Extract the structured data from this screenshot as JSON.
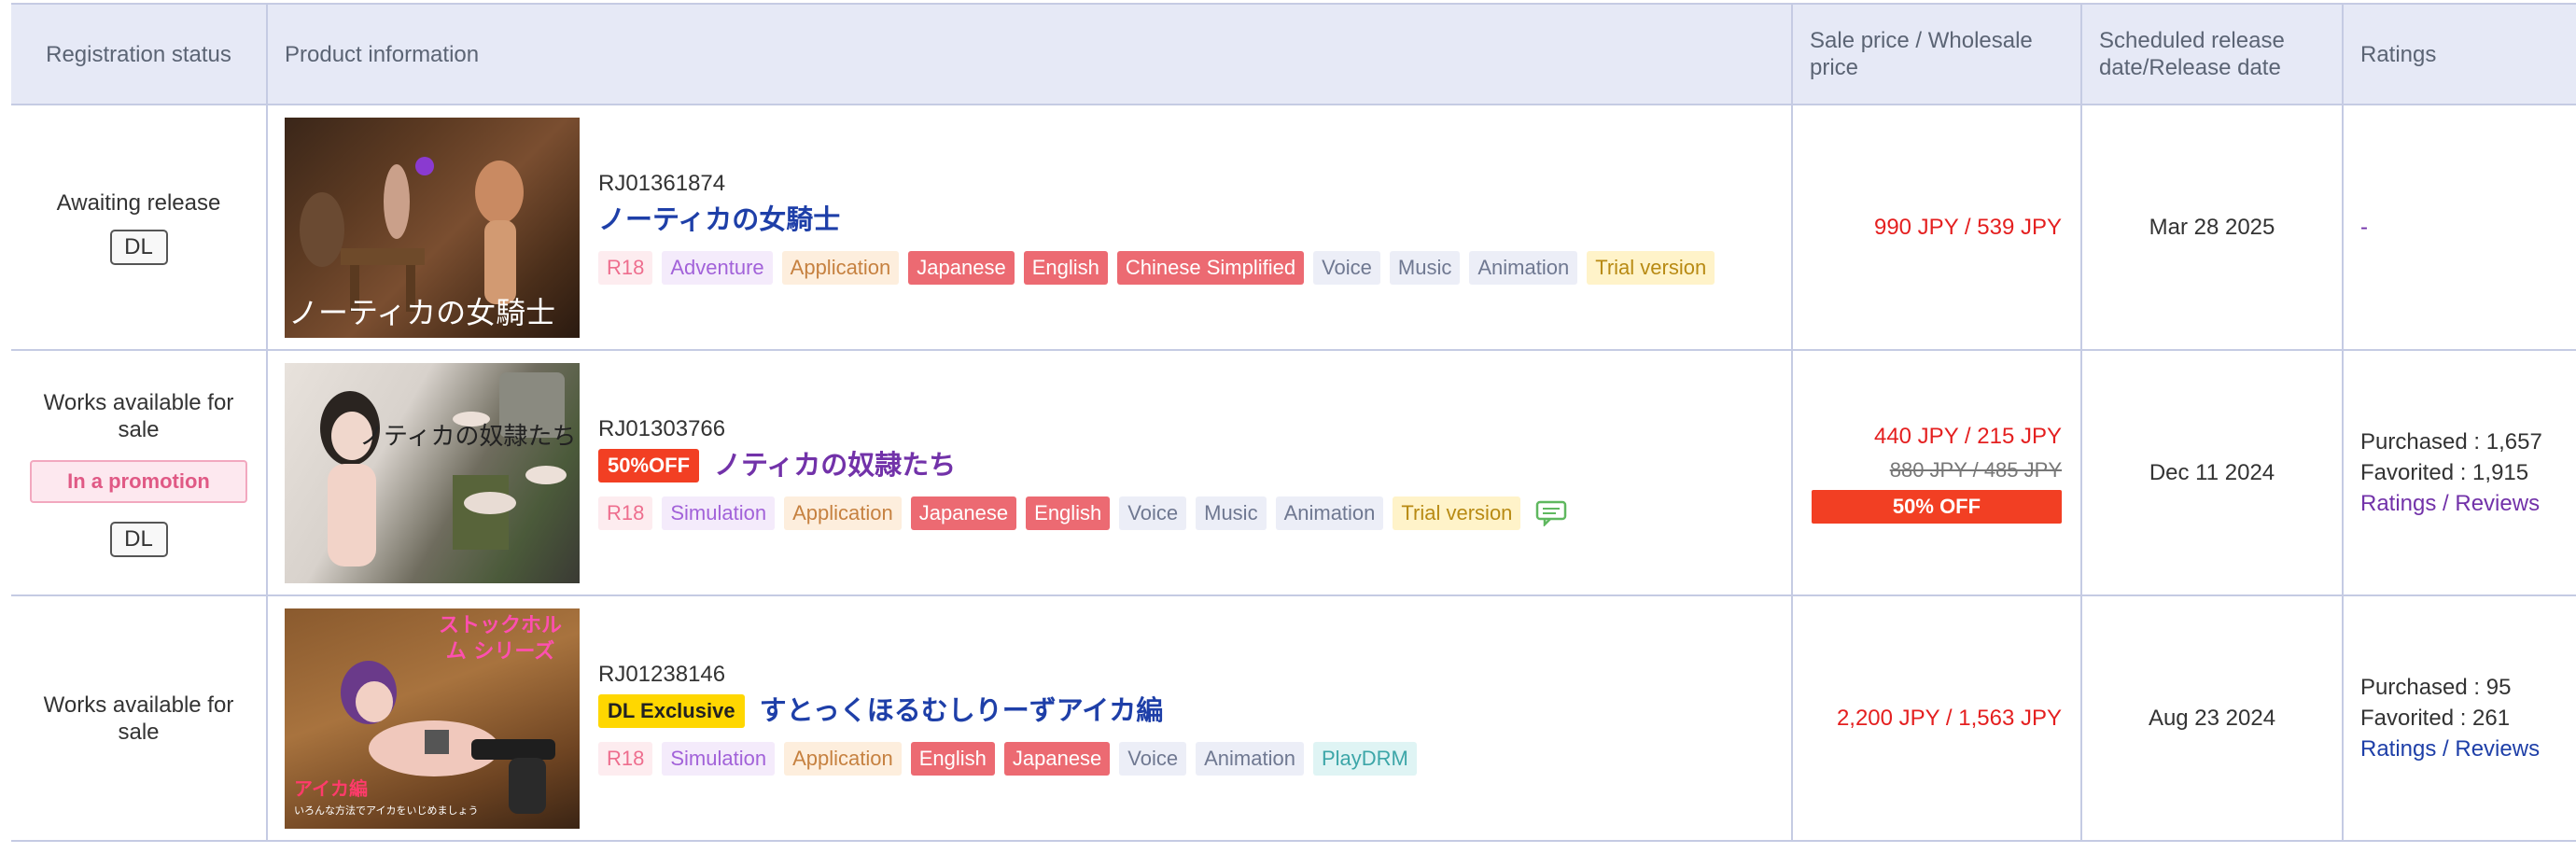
{
  "columns": {
    "status": "Registration status",
    "product": "Product information",
    "price": "Sale price / Wholesale price",
    "date": "Scheduled release date/Release date",
    "ratings": "Ratings"
  },
  "rows": [
    {
      "status": "Awaiting release",
      "promo": "",
      "dl_badge": "DL",
      "thumb_text": "ノーティカの女騎士",
      "work_id": "RJ01361874",
      "title": "ノーティカの女騎士",
      "pre_badge": "",
      "tags": [
        "R18",
        "Adventure",
        "Application",
        "Japanese",
        "English",
        "Chinese Simplified",
        "Voice",
        "Music",
        "Animation",
        "Trial version"
      ],
      "price": "990 JPY / 539 JPY",
      "old_price": "",
      "off_label": "",
      "date": "Mar 28 2025",
      "purchased": "",
      "favorited": "",
      "reviews_link": "",
      "ratings_empty": "-"
    },
    {
      "status": "Works available for sale",
      "promo": "In a promotion",
      "dl_badge": "DL",
      "thumb_text": "ノティカの奴隷たち",
      "work_id": "RJ01303766",
      "title": "ノティカの奴隷たち",
      "pre_badge": "50%OFF",
      "tags": [
        "R18",
        "Simulation",
        "Application",
        "Japanese",
        "English",
        "Voice",
        "Music",
        "Animation",
        "Trial version"
      ],
      "price": "440 JPY / 215 JPY",
      "old_price": "880 JPY / 485 JPY",
      "off_label": "50% OFF",
      "date": "Dec 11 2024",
      "purchased": "Purchased : 1,657",
      "favorited": "Favorited : 1,915",
      "reviews_link": "Ratings / Reviews",
      "ratings_empty": ""
    },
    {
      "status": "Works available for sale",
      "promo": "",
      "dl_badge": "",
      "thumb_text": "ストックホルム シリーズ",
      "thumb_sub": "アイカ編",
      "thumb_caption": "いろんな方法でアイカをいじめましょう",
      "work_id": "RJ01238146",
      "title": "すとっくほるむしりーずアイカ編",
      "pre_badge": "DL Exclusive",
      "tags": [
        "R18",
        "Simulation",
        "Application",
        "English",
        "Japanese",
        "Voice",
        "Animation",
        "PlayDRM"
      ],
      "price": "2,200 JPY / 1,563 JPY",
      "old_price": "",
      "off_label": "",
      "date": "Aug 23 2024",
      "purchased": "Purchased : 95",
      "favorited": "Favorited : 261",
      "reviews_link": "Ratings / Reviews",
      "ratings_empty": ""
    }
  ]
}
